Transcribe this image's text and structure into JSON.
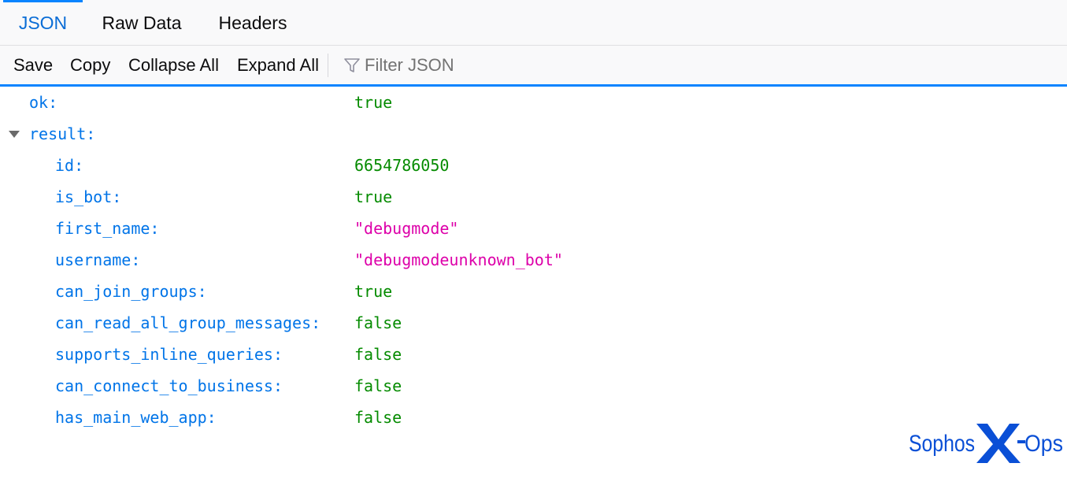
{
  "tabs": [
    {
      "label": "JSON",
      "active": true
    },
    {
      "label": "Raw Data",
      "active": false
    },
    {
      "label": "Headers",
      "active": false
    }
  ],
  "toolbar": {
    "save_label": "Save",
    "copy_label": "Copy",
    "collapse_label": "Collapse All",
    "expand_label": "Expand All",
    "filter_placeholder": "Filter JSON",
    "filter_value": ""
  },
  "json": {
    "rows": [
      {
        "key": "ok:",
        "value": "true",
        "type": "literal",
        "depth": 0
      },
      {
        "key": "result:",
        "value": "",
        "type": "object",
        "depth": 0,
        "expanded": true
      },
      {
        "key": "id:",
        "value": "6654786050",
        "type": "literal",
        "depth": 1
      },
      {
        "key": "is_bot:",
        "value": "true",
        "type": "literal",
        "depth": 1
      },
      {
        "key": "first_name:",
        "value": "\"debugmode\"",
        "type": "string",
        "depth": 1
      },
      {
        "key": "username:",
        "value": "\"debugmodeunknown_bot\"",
        "type": "string",
        "depth": 1
      },
      {
        "key": "can_join_groups:",
        "value": "true",
        "type": "literal",
        "depth": 1
      },
      {
        "key": "can_read_all_group_messages:",
        "value": "false",
        "type": "literal",
        "depth": 1
      },
      {
        "key": "supports_inline_queries:",
        "value": "false",
        "type": "literal",
        "depth": 1
      },
      {
        "key": "can_connect_to_business:",
        "value": "false",
        "type": "literal",
        "depth": 1
      },
      {
        "key": "has_main_web_app:",
        "value": "false",
        "type": "literal",
        "depth": 1
      }
    ]
  },
  "watermark": {
    "text": "Sophos X-Ops"
  },
  "colors": {
    "accent": "#0a84ff",
    "key": "#0074e8",
    "literal": "#058b00",
    "string": "#dd00a9",
    "logo": "#0a4fd6"
  },
  "icons": {
    "filter": "filter-funnel-icon",
    "twisty": "expand-triangle-icon"
  }
}
